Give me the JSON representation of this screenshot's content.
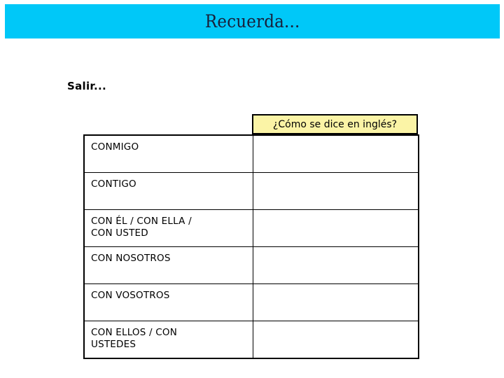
{
  "banner": {
    "title": "Recuerda...",
    "background_color": "#00c8f8",
    "text_color": "#18203a"
  },
  "subtitle": "Salir...",
  "question_header": {
    "label": "¿Cómo se dice en inglés?",
    "background_color": "#fbf4a6",
    "border_color": "#000000"
  },
  "table": {
    "columns": [
      "",
      "¿Cómo se dice en inglés?"
    ],
    "rows": [
      {
        "term": "CONMIGO",
        "answer": ""
      },
      {
        "term": "CONTIGO",
        "answer": ""
      },
      {
        "term": "CON ÉL / CON ELLA /\nCON USTED",
        "answer": ""
      },
      {
        "term": "CON NOSOTROS",
        "answer": ""
      },
      {
        "term": "CON VOSOTROS",
        "answer": ""
      },
      {
        "term": "CON ELLOS / CON\nUSTEDES",
        "answer": ""
      }
    ]
  },
  "page": {
    "background_color": "#ffffff"
  }
}
